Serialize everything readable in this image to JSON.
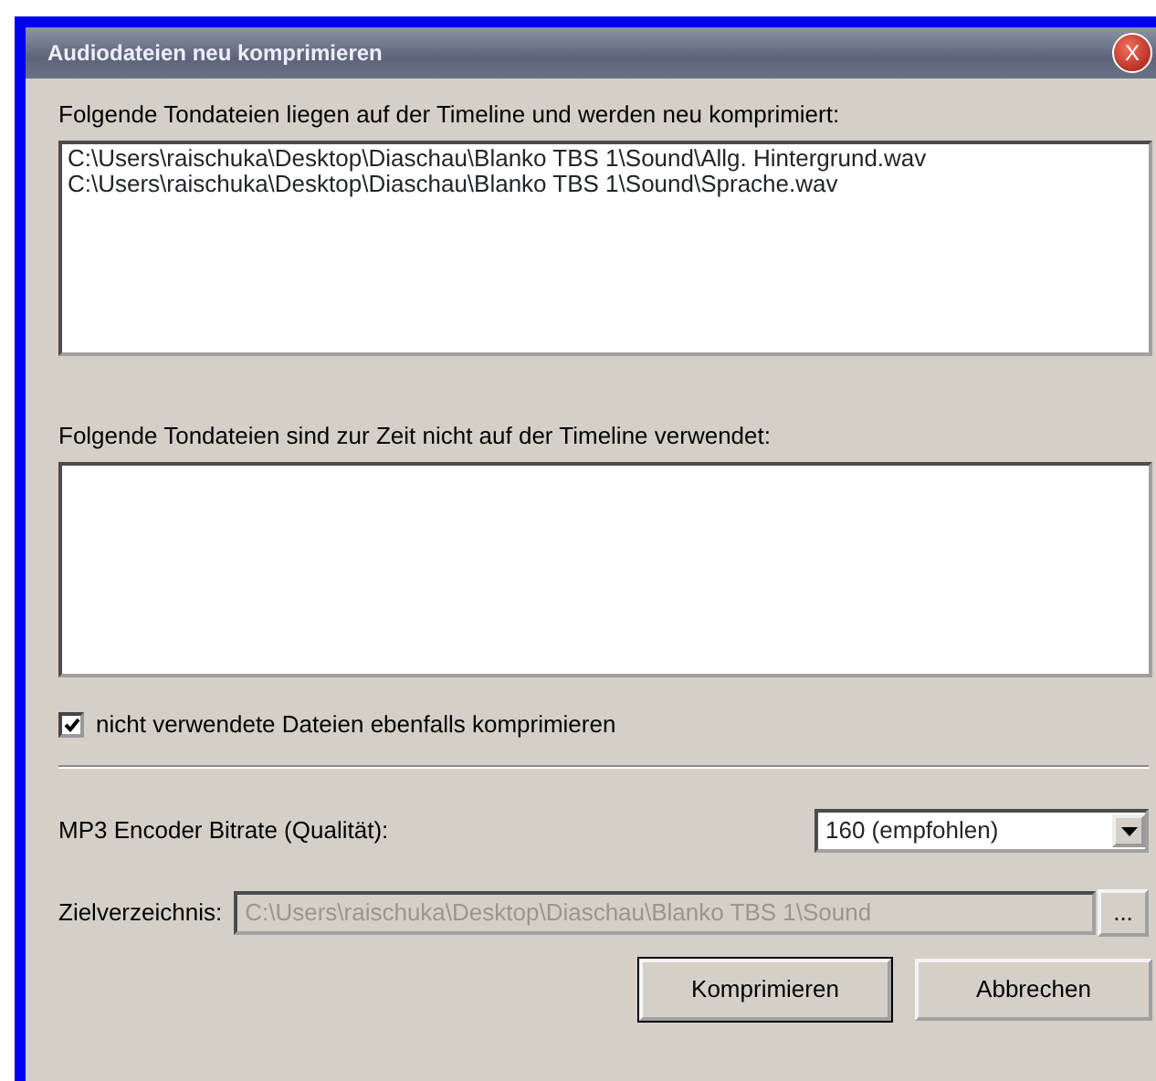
{
  "window": {
    "title": "Audiodateien neu komprimieren",
    "close": "X"
  },
  "used_files": {
    "label": "Folgende Tondateien liegen auf der Timeline und werden neu komprimiert:",
    "items": [
      "C:\\Users\\raischuka\\Desktop\\Diaschau\\Blanko TBS 1\\Sound\\Allg. Hintergrund.wav",
      "C:\\Users\\raischuka\\Desktop\\Diaschau\\Blanko TBS 1\\Sound\\Sprache.wav"
    ]
  },
  "unused_files": {
    "label": "Folgende Tondateien sind zur Zeit nicht auf der Timeline verwendet:"
  },
  "compress_unused": {
    "label": "nicht verwendete Dateien ebenfalls komprimieren",
    "checked": true
  },
  "bitrate": {
    "label": "MP3 Encoder Bitrate (Qualität):",
    "value": "160 (empfohlen)"
  },
  "target": {
    "label": "Zielverzeichnis:",
    "value": "C:\\Users\\raischuka\\Desktop\\Diaschau\\Blanko TBS 1\\Sound",
    "disabled": true,
    "browse": "..."
  },
  "buttons": [
    "Komprimieren",
    "Abbrechen"
  ]
}
